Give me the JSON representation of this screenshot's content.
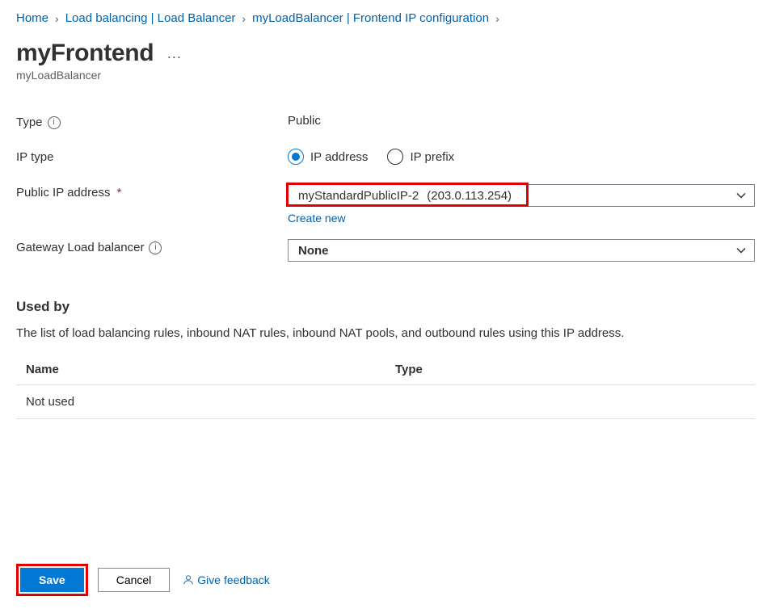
{
  "breadcrumb": {
    "items": [
      {
        "label": "Home",
        "link": true
      },
      {
        "label": "Load balancing | Load Balancer",
        "link": true
      },
      {
        "label": "myLoadBalancer | Frontend IP configuration",
        "link": true
      }
    ]
  },
  "header": {
    "title": "myFrontend",
    "subtitle": "myLoadBalancer",
    "more": "···"
  },
  "form": {
    "type_label": "Type",
    "type_value": "Public",
    "iptype_label": "IP type",
    "iptype_options": [
      "IP address",
      "IP prefix"
    ],
    "pip_label": "Public IP address",
    "pip_name": "myStandardPublicIP-2",
    "pip_ip": "(203.0.113.254)",
    "create_new": "Create new",
    "gateway_label": "Gateway Load balancer",
    "gateway_value": "None"
  },
  "used_by": {
    "heading": "Used by",
    "description": "The list of load balancing rules, inbound NAT rules, inbound NAT pools, and outbound rules using this IP address.",
    "columns": [
      "Name",
      "Type"
    ],
    "rows": [
      [
        "Not used",
        ""
      ]
    ]
  },
  "footer": {
    "save": "Save",
    "cancel": "Cancel",
    "feedback": "Give feedback"
  }
}
